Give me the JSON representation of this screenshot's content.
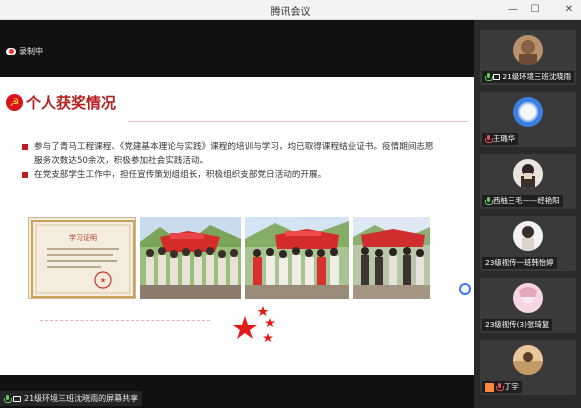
{
  "window": {
    "title": "腾讯会议",
    "minimize": "—",
    "restore": "☐",
    "maximize": "▢",
    "close": "✕"
  },
  "recording": {
    "label": "录制中"
  },
  "slide": {
    "title": "个人获奖情况",
    "bullets": [
      "参与了青马工程课程、《党建基本理论与实践》课程的培训与学习，均已取得课程结业证书。疫情期间志愿服务次数达50余次，积极参加社会实践活动。",
      "在党支部学生工作中，担任宣传策划组组长，积极组织支部党日活动的开展。"
    ],
    "certificate": {
      "heading": "学习证明"
    }
  },
  "share": {
    "label": "21级环境三班沈晓雨的屏幕共享"
  },
  "participants": [
    {
      "name": "21级环境三班沈晓雨",
      "mic": "on",
      "sharing": true
    },
    {
      "name": "王璐华",
      "mic": "off"
    },
    {
      "name": "西柚三毛——经艳阳",
      "mic": "on"
    },
    {
      "name": "23级视传一班韩怡婷",
      "mic": "none"
    },
    {
      "name": "23级视传(3)张琦复",
      "mic": "none"
    },
    {
      "name": "丁宇",
      "mic": "off"
    }
  ],
  "colors": {
    "accent_red": "#c31b1b",
    "title_red": "#b51f1f",
    "tile_bg": "#3a3a3a",
    "mic_on": "#5fd05f",
    "mic_off": "#f05050"
  }
}
